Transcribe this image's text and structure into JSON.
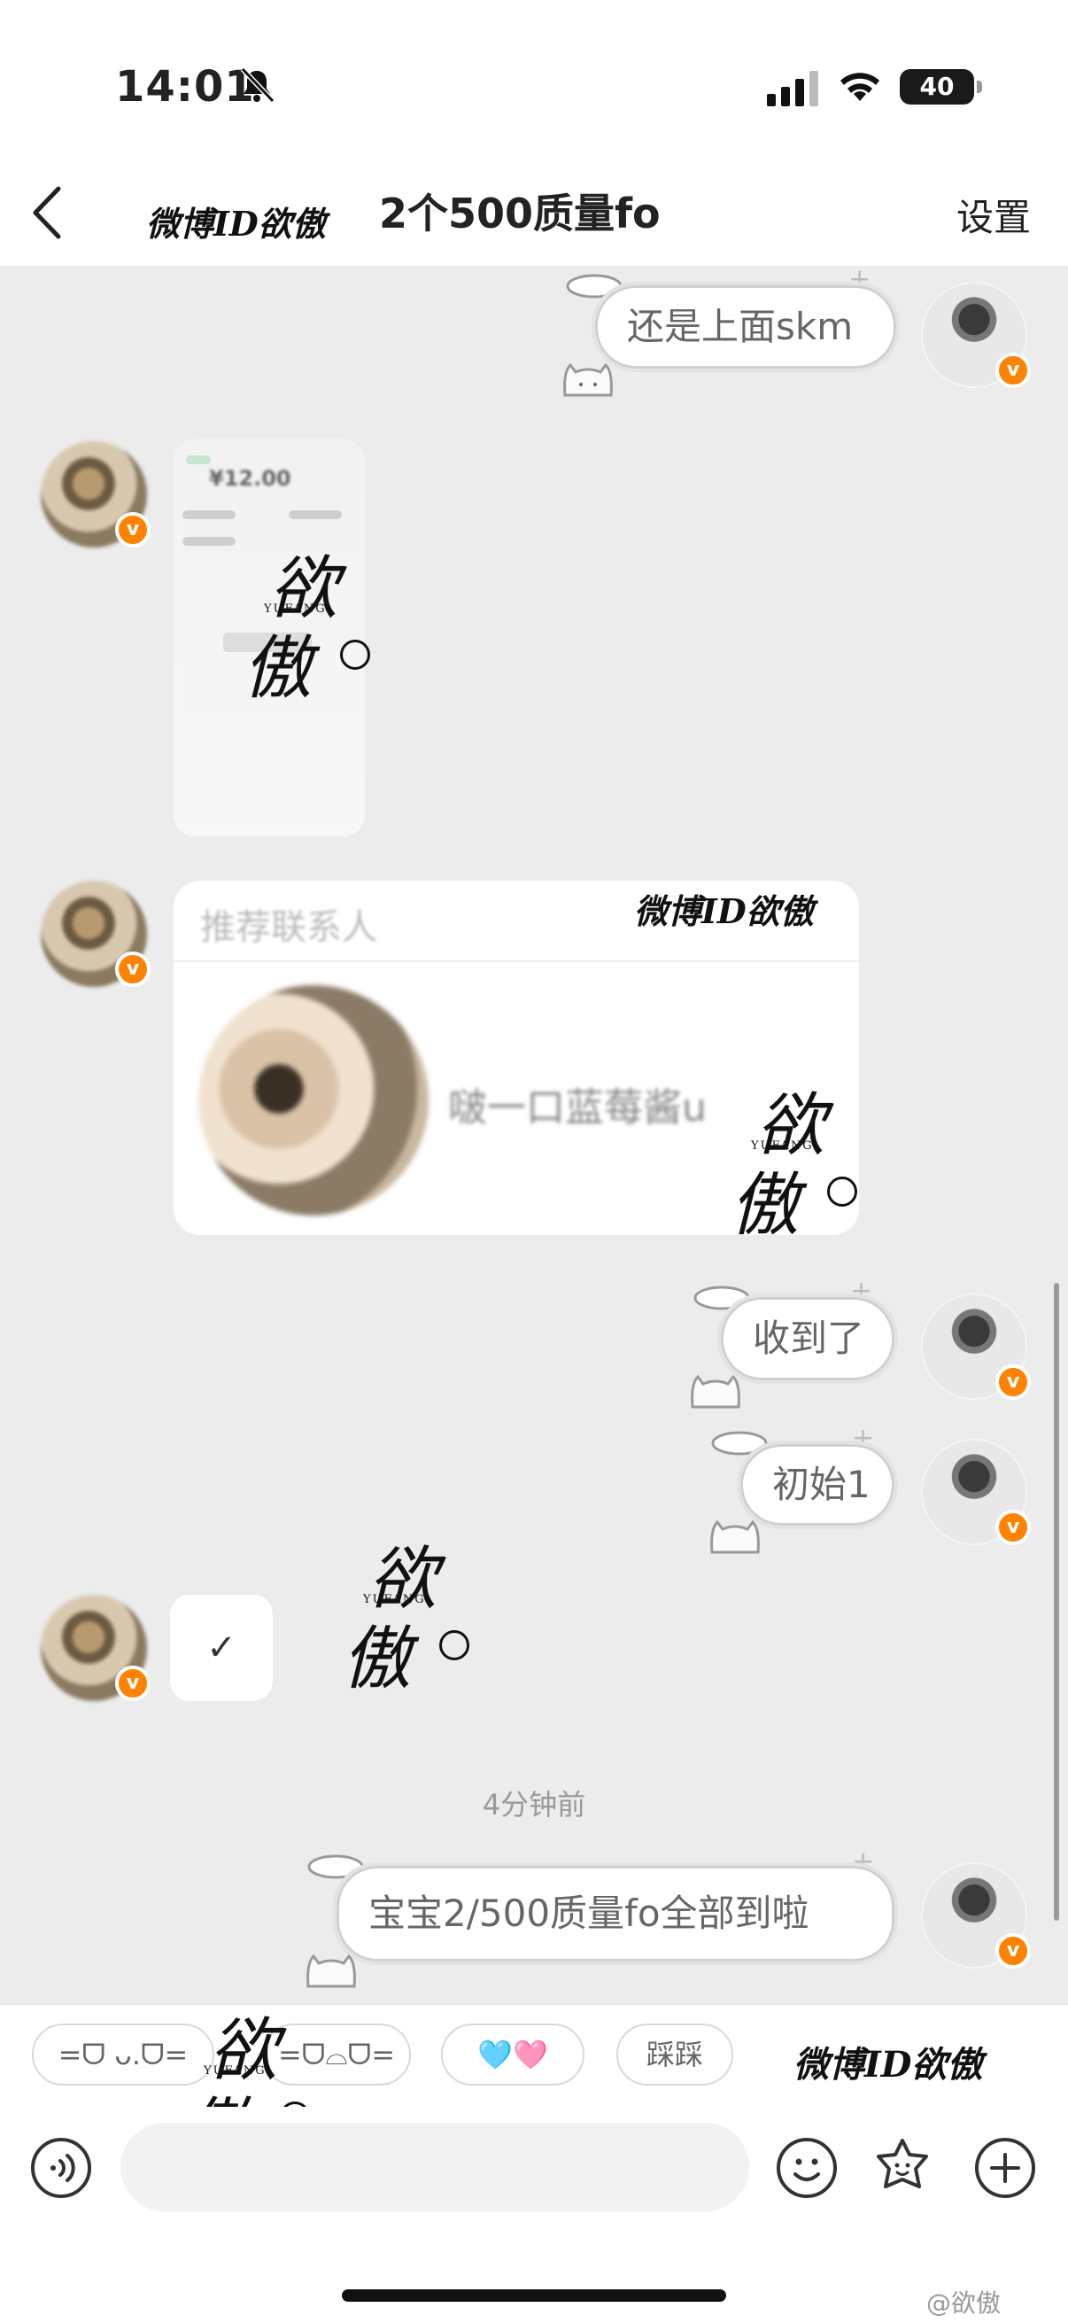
{
  "status_bar": {
    "time": "14:01",
    "battery_level": "40",
    "icons": [
      "bell-slash-icon",
      "signal-icon",
      "wifi-icon",
      "battery-icon"
    ]
  },
  "nav": {
    "back_icon": "chevron-left-icon",
    "watermark": "微博ID欲傲",
    "title": "2个500质量fo",
    "settings_label": "设置"
  },
  "messages": [
    {
      "from": "me",
      "type": "text",
      "text": "还是上面skm"
    },
    {
      "from": "peer",
      "type": "image",
      "image_amount": "¥12.00"
    },
    {
      "from": "peer",
      "type": "contact_card",
      "card_header": "推荐联系人",
      "card_watermark": "微博ID欲傲",
      "contact_name": "啵一口蓝莓酱u"
    },
    {
      "from": "me",
      "type": "text",
      "text": "收到了"
    },
    {
      "from": "me",
      "type": "text",
      "text": "初始1"
    },
    {
      "from": "peer",
      "type": "text",
      "text": "✓"
    },
    {
      "type": "timestamp",
      "text": "4分钟前"
    },
    {
      "from": "me",
      "type": "text",
      "text": "宝宝2/500质量fo全部到啦"
    }
  ],
  "watermark_logo": {
    "char1": "欲",
    "char2": "傲",
    "sub": "YUFANG"
  },
  "quick_replies": [
    "=ᗜ ᴗ.ᗜ=",
    "=ᗜ⌓ᗜ=",
    "🩵🩷",
    "踩踩"
  ],
  "quickbar_watermark": "微博ID欲傲",
  "input": {
    "placeholder": ""
  },
  "input_icons": [
    "voice-icon",
    "emoji-icon",
    "sticker-icon",
    "plus-icon"
  ],
  "footer_credit": "@欲傲",
  "colors": {
    "accent_badge": "#ff8200",
    "chat_bg": "#ececec"
  }
}
